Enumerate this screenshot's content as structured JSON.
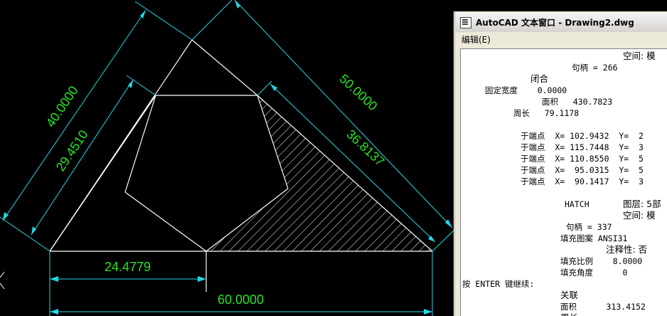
{
  "drawing": {
    "dimensions": {
      "d1": "40.0000",
      "d2": "29.4510",
      "d3": "50.0000",
      "d4": "36.8137",
      "d5": "24.4779",
      "d6": "60.0000"
    }
  },
  "text_window": {
    "title": "AutoCAD 文本窗口 - Drawing2.dwg",
    "menu": [
      "编辑(E)"
    ],
    "lines": [
      "空间: 模",
      "句柄 = 266",
      "闭合",
      "固定宽度    0.0000",
      "面积   430.7823",
      "周长   79.1178",
      "于端点  X= 102.9432  Y=  2",
      "于端点  X= 115.7448  Y=  3",
      "于端点  X= 110.8550  Y=  5",
      "于端点  X=  95.0315  Y=  5",
      "于端点  X=  90.1417  Y=  3",
      "HATCH",
      "图层: 5部",
      "空间: 模",
      "句柄 = 337",
      "填充图案 ANSI31",
      "注释性: 否",
      "填充比例    8.0000",
      "填充角度      0",
      "按 ENTER 键继续:",
      "关联",
      "面积      313.4152",
      "周长"
    ]
  }
}
